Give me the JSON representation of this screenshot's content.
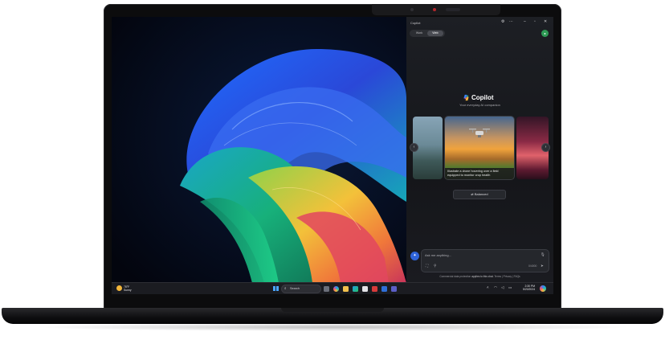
{
  "copilot": {
    "window_title": "Copilot",
    "modes": [
      "Work",
      "Web"
    ],
    "active_mode": "Web",
    "brand": "Copilot",
    "tagline": "Your everyday AI companion",
    "card_caption": "Illustrate a drone hovering over a field equipped to monitor crop health",
    "tone_button": "Balanced",
    "composer": {
      "placeholder": "Ask me anything...",
      "char_count": "0/4000"
    },
    "footer": {
      "prefix": "Commercial data protection",
      "highlight": "applies to this chat.",
      "links": "Terms | Privacy | FAQs"
    }
  },
  "taskbar": {
    "weather": {
      "temp": "78°F",
      "condition": "Sunny"
    },
    "search_label": "Search",
    "clock": {
      "time": "2:30 PM",
      "date": "5/20/2024"
    }
  },
  "colors": {
    "accent": "#2f64d8",
    "avatar": "#2e9a55",
    "panel_bg": "#17181c"
  }
}
